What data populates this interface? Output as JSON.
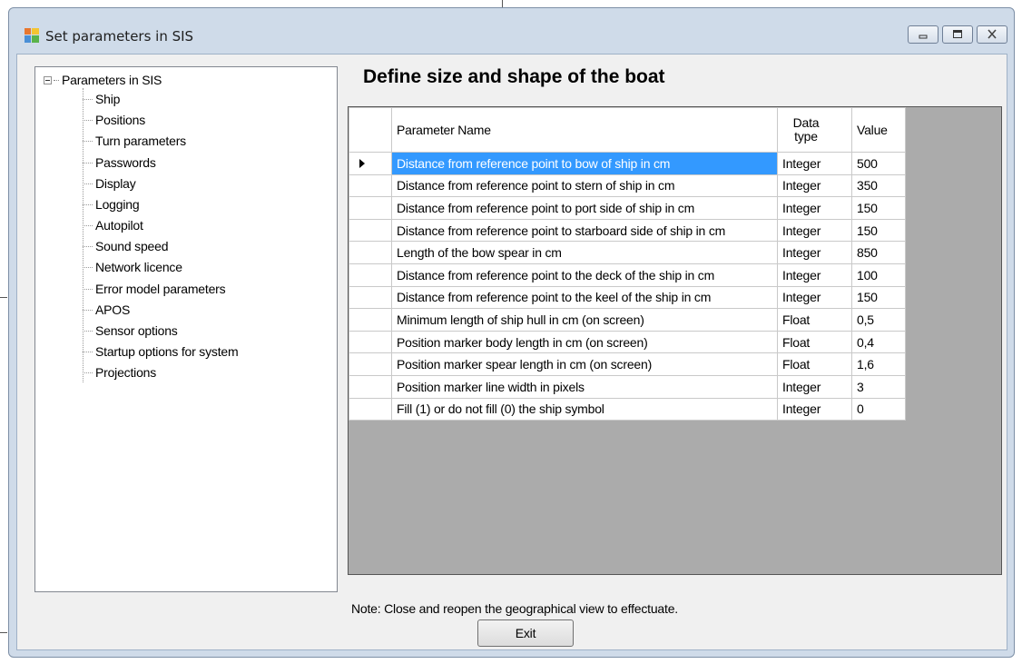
{
  "window": {
    "title": "Set parameters in SIS",
    "icon": "app-icon",
    "controls": [
      "minimize-icon",
      "maximize-icon",
      "close-icon"
    ]
  },
  "tree": {
    "root_label": "Parameters in SIS",
    "items": [
      "Ship",
      "Positions",
      "Turn parameters",
      "Passwords",
      "Display",
      "Logging",
      "Autopilot",
      "Sound speed",
      "Network licence",
      "Error model parameters",
      "APOS",
      "Sensor options",
      "Startup options for system",
      "Projections"
    ]
  },
  "main": {
    "heading": "Define size and shape of the boat",
    "grid": {
      "columns": {
        "name": "Parameter Name",
        "type": "Data type",
        "value": "Value"
      },
      "rows": [
        {
          "name": "Distance from reference point to bow of ship in cm",
          "type": "Integer",
          "value": "500"
        },
        {
          "name": "Distance from reference point to stern of ship in cm",
          "type": "Integer",
          "value": "350"
        },
        {
          "name": "Distance from reference point to port side of ship in cm",
          "type": "Integer",
          "value": "150"
        },
        {
          "name": "Distance from reference point to starboard side of ship in cm",
          "type": "Integer",
          "value": "150"
        },
        {
          "name": "Length of the bow spear in cm",
          "type": "Integer",
          "value": "850"
        },
        {
          "name": "Distance from reference point to the deck of the ship in cm",
          "type": "Integer",
          "value": "100"
        },
        {
          "name": "Distance from reference point to the keel of the ship in cm",
          "type": "Integer",
          "value": "150"
        },
        {
          "name": "Minimum length of ship hull in cm (on screen)",
          "type": "Float",
          "value": "0,5"
        },
        {
          "name": "Position marker body length in cm (on screen)",
          "type": "Float",
          "value": "0,4"
        },
        {
          "name": "Position marker spear length in cm (on screen)",
          "type": "Float",
          "value": "1,6"
        },
        {
          "name": "Position marker line width in pixels",
          "type": "Integer",
          "value": "3"
        },
        {
          "name": "Fill (1) or do not fill (0) the ship symbol",
          "type": "Integer",
          "value": "0"
        }
      ]
    },
    "note": "Note: Close and reopen the geographical view to effectuate.",
    "exit_label": "Exit"
  },
  "colors": {
    "selection": "#3399ff",
    "grid_background": "#ababab",
    "window_frame": "#cfdbe9"
  }
}
